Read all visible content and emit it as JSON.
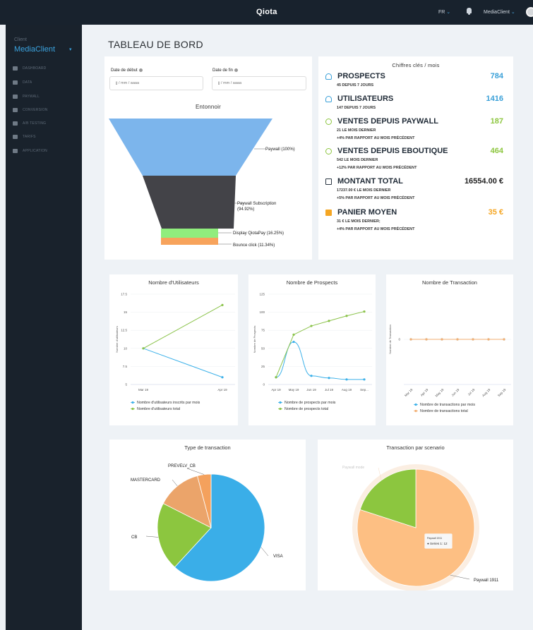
{
  "topbar": {
    "title": "Qiota",
    "lang": "FR",
    "user": "MediaClient"
  },
  "sidebar": {
    "client_label": "Client",
    "client_name": "MediaClient",
    "items": [
      {
        "label": "DASHBOARD"
      },
      {
        "label": "DATA"
      },
      {
        "label": "PAYWALL"
      },
      {
        "label": "CONVERSION"
      },
      {
        "label": "A/B TESTING"
      },
      {
        "label": "TARIFS"
      },
      {
        "label": "APPLICATION"
      }
    ]
  },
  "page_title": "TABLEAU DE BORD",
  "filters": {
    "start_label": "Date de début",
    "start_placeholder": "jj / mm / aaaa",
    "end_label": "Date de fin",
    "end_placeholder": "jj / mm / aaaa"
  },
  "funnel": {
    "title": "Entonnoir",
    "stages": [
      {
        "label": "Paywall (100%)",
        "pct": 100,
        "color": "#7cb5ec"
      },
      {
        "label": "Paywall Subscription (94.92%)",
        "pct": 94.92,
        "color": "#434348"
      },
      {
        "label": "Display QiotaPay (16.25%)",
        "pct": 16.25,
        "color": "#90ed7d"
      },
      {
        "label": "Bounce click (11.34%)",
        "pct": 11.34,
        "color": "#f7a35c"
      }
    ]
  },
  "kpis": {
    "title": "Chiffres clés / mois",
    "items": [
      {
        "label": "PROSPECTS",
        "value": "784",
        "color": "#3aa0d8",
        "sub1": "45 DEPUIS 7 JOURS",
        "sub2": "",
        "icon": "user-icon"
      },
      {
        "label": "UTILISATEURS",
        "value": "1416",
        "color": "#3aa0d8",
        "sub1": "147 DEPUIS 7 JOURS",
        "sub2": "",
        "icon": "user-icon"
      },
      {
        "label": "VENTES DEPUIS PAYWALL",
        "value": "187",
        "color": "#8dc63f",
        "sub1": "21 LE MOIS DERNIER",
        "sub2": "+4% PAR RAPPORT AU MOIS PRÉCÉDENT",
        "icon": "plus-circle-icon"
      },
      {
        "label": "VENTES DEPUIS EBOUTIQUE",
        "value": "464",
        "color": "#8dc63f",
        "sub1": "542 LE MOIS DERNIER",
        "sub2": "+12% PAR RAPPORT AU MOIS PRÉCÉDENT",
        "icon": "plus-circle-icon"
      },
      {
        "label": "MONTANT TOTAL",
        "value": "16554.00 €",
        "color": "#222222",
        "sub1": "17237.00 € LE MOIS DERNIER",
        "sub2": "+5% PAR RAPPORT AU MOIS PRÉCÉDENT",
        "icon": "receipt-icon"
      },
      {
        "label": "PANIER MOYEN",
        "value": "35 €",
        "color": "#f5a623",
        "sub1": "31 € LE MOIS DERNIER;",
        "sub2": "+4% PAR RAPPORT AU MOIS PRÉCÉDENT",
        "icon": "table-icon"
      }
    ]
  },
  "chart_data": [
    {
      "type": "line",
      "title": "Nombre d'Utilisateurs",
      "ylabel": "Nombre d'utilisateurs",
      "categories": [
        "Mar 19",
        "Apr 19"
      ],
      "yticks": [
        5,
        7.5,
        10,
        12.5,
        15,
        17.5
      ],
      "ylim": [
        5,
        17.5
      ],
      "series": [
        {
          "name": "Nombre d'utilisateurs inscrits par mois",
          "color": "#3db1e9",
          "values": [
            10,
            6
          ]
        },
        {
          "name": "Nombre d'utilisateurs total",
          "color": "#8bc34a",
          "values": [
            10,
            16
          ]
        }
      ]
    },
    {
      "type": "line",
      "title": "Nombre de Prospects",
      "ylabel": "Nombre de Prospects",
      "categories": [
        "Apr 19",
        "May 19",
        "Jun 19",
        "Jul 19",
        "Aug 19",
        "Sep..."
      ],
      "yticks": [
        0,
        25,
        50,
        75,
        100,
        125
      ],
      "ylim": [
        0,
        125
      ],
      "series": [
        {
          "name": "Nombre de prospects par mois",
          "color": "#3db1e9",
          "values": [
            10,
            59,
            12,
            9,
            7,
            7
          ]
        },
        {
          "name": "Nombre de prospects total",
          "color": "#8bc34a",
          "values": [
            10,
            69,
            81,
            88,
            95,
            101
          ]
        }
      ]
    },
    {
      "type": "line",
      "title": "Nombre de Transaction",
      "ylabel": "Nombre de Transaction",
      "categories": [
        "Mar 19",
        "Apr 19",
        "May 19",
        "Jun 19",
        "Jul 19",
        "Aug 19",
        "Sep 19"
      ],
      "yticks": [
        0
      ],
      "ylim": [
        -1,
        1
      ],
      "series": [
        {
          "name": "Nombre de transactions par mois",
          "color": "#3db1e9",
          "values": [
            0,
            0,
            0,
            0,
            0,
            0,
            0
          ]
        },
        {
          "name": "Nombre de transactions total",
          "color": "#f2ae72",
          "values": [
            0,
            0,
            0,
            0,
            0,
            0,
            0
          ]
        }
      ]
    },
    {
      "type": "pie",
      "title": "Type de transaction",
      "slices": [
        {
          "name": "VISA",
          "value": 60,
          "color": "#3aaee8"
        },
        {
          "name": "CB",
          "value": 20,
          "color": "#8cc63f"
        },
        {
          "name": "MASTERCARD",
          "value": 13,
          "color": "#eba46a"
        },
        {
          "name": "PREVELV_CB",
          "value": 4,
          "color": "#f4a15d"
        }
      ]
    },
    {
      "type": "pie",
      "title": "Transaction par scenario",
      "slices": [
        {
          "name": "Paywall 1911",
          "value": 80,
          "color": "#fdbf83"
        },
        {
          "name": "Paywall mode",
          "value": 20,
          "color": "#8cc63f"
        }
      ],
      "tooltip": {
        "line1": "Paywall 1911",
        "line2": "● Series 1: 12"
      }
    }
  ]
}
